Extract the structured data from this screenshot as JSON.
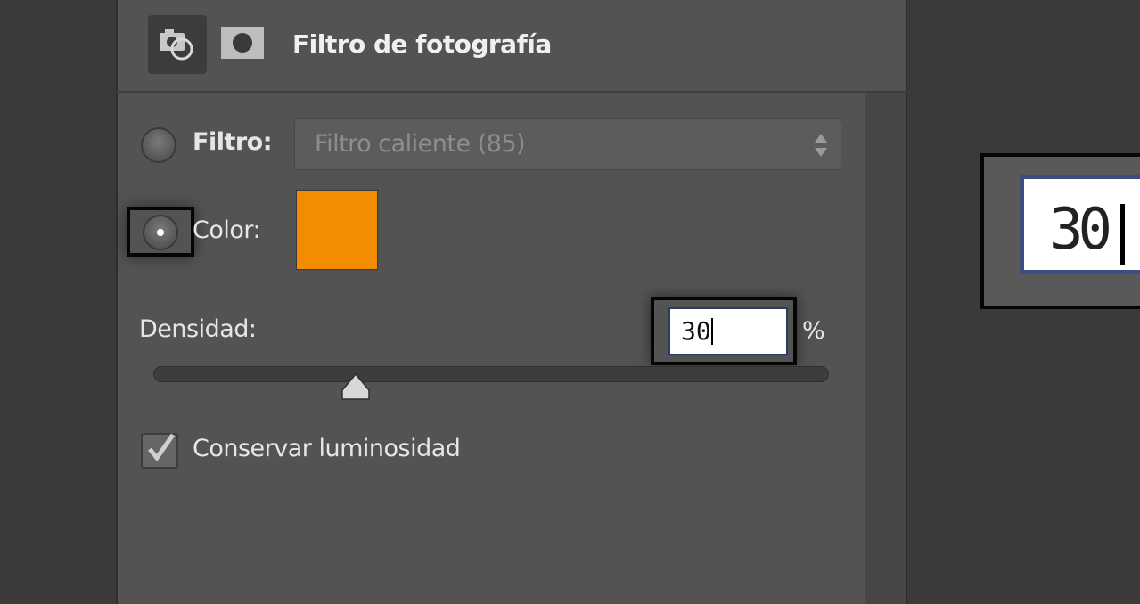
{
  "panel": {
    "title": "Filtro de fotografía",
    "tabs": [
      {
        "icon": "camera-filter-icon",
        "active": true
      },
      {
        "icon": "mask-icon",
        "active": false
      }
    ]
  },
  "filter_option": {
    "label": "Filtro:",
    "selected": false,
    "dropdown_value": "Filtro caliente (85)"
  },
  "color_option": {
    "label": "Color:",
    "selected": true,
    "swatch_color": "#f28c00"
  },
  "density": {
    "label": "Densidad:",
    "value": "30",
    "unit": "%",
    "slider_percent": 30
  },
  "preserve_luminosity": {
    "label": "Conservar luminosidad",
    "checked": true
  },
  "zoom_callout": {
    "value": "30"
  }
}
